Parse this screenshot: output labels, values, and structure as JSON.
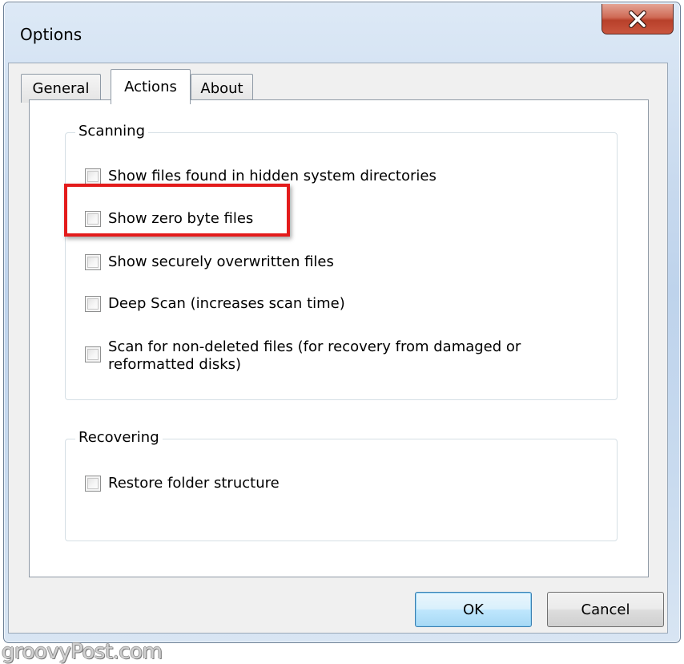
{
  "window": {
    "title": "Options",
    "close_label": "x"
  },
  "tabs": [
    {
      "label": "General",
      "active": false
    },
    {
      "label": "Actions",
      "active": true
    },
    {
      "label": "About",
      "active": false
    }
  ],
  "scanning": {
    "label": "Scanning",
    "options": [
      {
        "label": "Show files found in hidden system directories",
        "checked": false
      },
      {
        "label": "Show zero byte files",
        "checked": false
      },
      {
        "label": "Show securely overwritten files",
        "checked": false
      },
      {
        "label": "Deep Scan (increases scan time)",
        "checked": false
      },
      {
        "label": "Scan for non-deleted files (for recovery from damaged or reformatted disks)",
        "checked": false
      }
    ]
  },
  "recovering": {
    "label": "Recovering",
    "options": [
      {
        "label": "Restore folder structure",
        "checked": false
      }
    ]
  },
  "buttons": {
    "ok": "OK",
    "cancel": "Cancel"
  },
  "watermark": "groovyPost.com",
  "colors": {
    "highlight": "#e31b1b",
    "close_button": "#c9553e",
    "default_button": "#3c7fb1"
  }
}
